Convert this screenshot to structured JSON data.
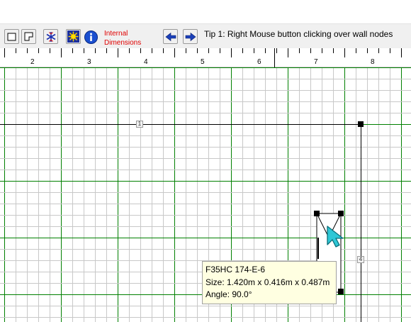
{
  "toolbar": {
    "internal_dimensions": {
      "line1": "Internal",
      "line2": "Dimensions"
    },
    "tip": "Tip 1: Right Mouse button clicking over wall nodes",
    "icons": [
      "rect-select-icon",
      "polygon-select-icon",
      "snowflake-icon",
      "sun-icon",
      "info-icon",
      "arrow-left-icon",
      "arrow-right-icon"
    ]
  },
  "ruler": {
    "labels": [
      "2",
      "3",
      "4",
      "5",
      "6",
      "7",
      "8"
    ]
  },
  "canvas": {
    "wall_markers": [
      "1",
      "4"
    ],
    "tooltip": {
      "name": "F35HC 174-E-6",
      "size": "Size: 1.420m x 0.416m x 0.487m",
      "angle": "Angle: 90.0°"
    }
  },
  "colors": {
    "toolbar_bg": "#f0f0f0",
    "grid_minor": "#c8c8c8",
    "grid_major": "#008000",
    "tooltip_bg": "#ffffe1",
    "cursor": "#2ec7d6",
    "internal_text": "#e00000"
  }
}
